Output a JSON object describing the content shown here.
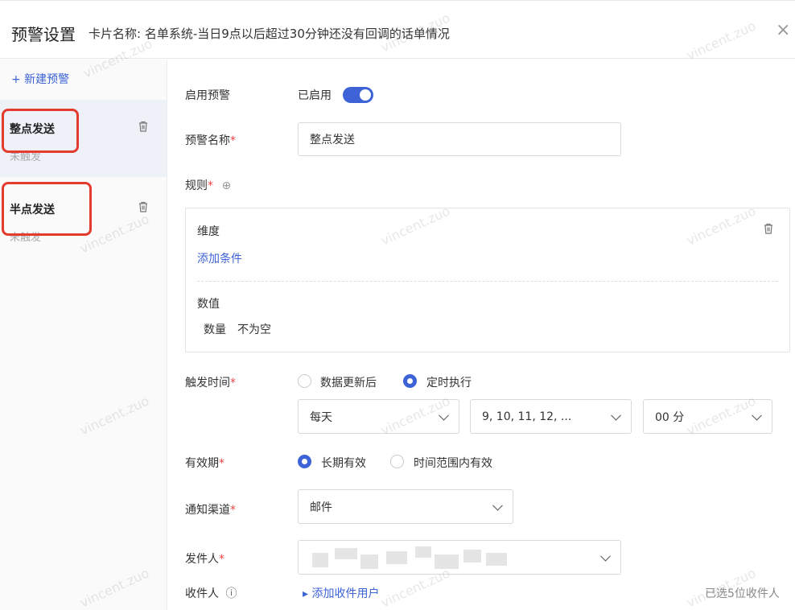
{
  "header": {
    "title": "预警设置",
    "card_name": "卡片名称: 名单系统-当日9点以后超过30分钟还没有回调的话单情况",
    "close": "×"
  },
  "sidebar": {
    "new_alert": "+ 新建预警",
    "items": [
      {
        "name": "整点发送",
        "status": "未触发"
      },
      {
        "name": "半点发送",
        "status": "未触发"
      }
    ],
    "trash_icon": "trash-icon"
  },
  "form": {
    "enable_label": "启用预警",
    "enable_status": "已启用",
    "name_label": "预警名称",
    "name_value": "整点发送",
    "rule_label": "规则",
    "rule_add": "⊕",
    "dimension_label": "维度",
    "add_condition": "添加条件",
    "value_label": "数值",
    "value_field": "数量",
    "value_condition": "不为空",
    "trigger_label": "触发时间",
    "trigger_options": [
      "数据更新后",
      "定时执行"
    ],
    "trigger_selected": "定时执行",
    "freq_value": "每天",
    "hour_value": "9,  10,  11,  12,  ...",
    "minute_value": "00 分",
    "validity_label": "有效期",
    "validity_options": [
      "长期有效",
      "时间范围内有效"
    ],
    "validity_selected": "长期有效",
    "channel_label": "通知渠道",
    "channel_value": "邮件",
    "sender_label": "发件人",
    "recipient_label": "收件人",
    "recipient_info": "ⓘ",
    "add_recipient": "▸  添加收件用户",
    "recipient_count": "已选5位收件人",
    "required_mark": "*"
  },
  "watermark": "vincent.zuo",
  "colors": {
    "accent": "#3d63d6",
    "highlight": "#e43b2f"
  }
}
